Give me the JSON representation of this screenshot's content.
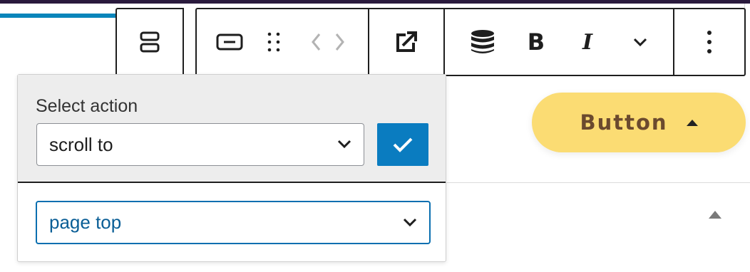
{
  "toolbar": {
    "icons": [
      "parent-block-icon",
      "button-block-icon",
      "drag-handle-icon",
      "move-arrows-icon",
      "link-external-icon",
      "database-icon",
      "bold-icon",
      "italic-icon",
      "chevron-down-icon",
      "more-options-icon"
    ],
    "bold_label": "B",
    "italic_label": "I"
  },
  "action_panel": {
    "label": "Select action",
    "action_select": {
      "value": "scroll to"
    },
    "target_select": {
      "value": "page top"
    }
  },
  "block_button": {
    "label": "Button"
  },
  "colors": {
    "accent": "#0a7cc0",
    "button_bg": "#fbdc73",
    "button_text": "#6b4a2e",
    "top_strip": "#2a1a3d"
  }
}
